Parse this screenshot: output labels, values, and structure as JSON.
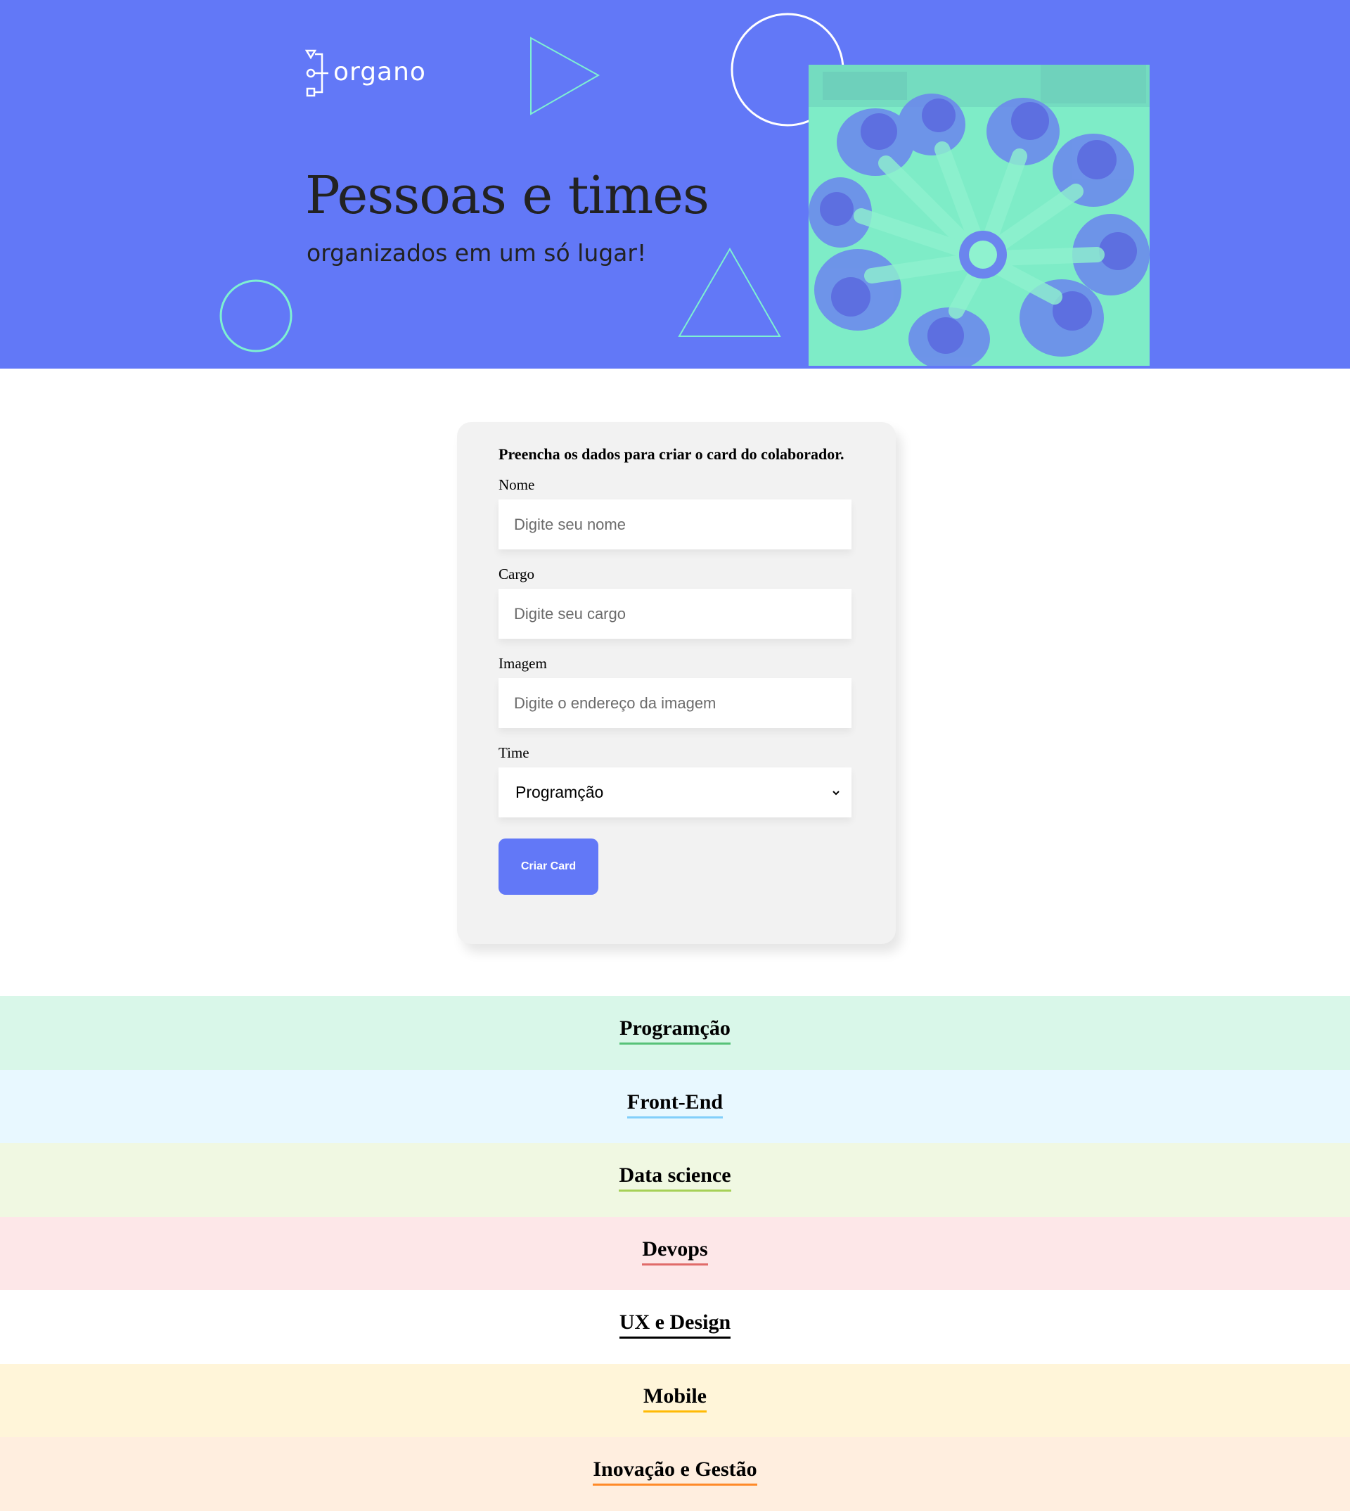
{
  "banner": {
    "logo_text": "organo",
    "title": "Pessoas e times",
    "subtitle": "organizados em um só lugar!",
    "background_color": "#6278f7",
    "shape_color": "#7ef0d2",
    "photo_tint": "#7eecc7",
    "icons": [
      "logo-mark-icon",
      "play-triangle-icon",
      "circle-icon",
      "triangle-icon",
      "team-hands-photo"
    ]
  },
  "form": {
    "heading": "Preencha os dados para criar o card do colaborador.",
    "name": {
      "label": "Nome",
      "placeholder": "Digite seu nome",
      "value": ""
    },
    "role": {
      "label": "Cargo",
      "placeholder": "Digite seu cargo",
      "value": ""
    },
    "image": {
      "label": "Imagem",
      "placeholder": "Digite o endereço da imagem",
      "value": ""
    },
    "team": {
      "label": "Time",
      "selected": "Programção"
    },
    "submit_label": "Criar Card",
    "button_color": "#6278f7"
  },
  "teams": [
    {
      "name": "Programção",
      "background": "#d9f7e9",
      "accent": "#57c278"
    },
    {
      "name": "Front-End",
      "background": "#e8f8ff",
      "accent": "#82cffa"
    },
    {
      "name": "Data science",
      "background": "#f0f8e2",
      "accent": "#a6d157"
    },
    {
      "name": "Devops",
      "background": "#fde7e8",
      "accent": "#e06b69"
    },
    {
      "name": "UX e Design",
      "background": "#ffffff",
      "accent": "#000000"
    },
    {
      "name": "Mobile",
      "background": "#fff5d9",
      "accent": "#ffba05"
    },
    {
      "name": "Inovação e Gestão",
      "background": "#ffeedf",
      "accent": "#ff8a29"
    }
  ]
}
